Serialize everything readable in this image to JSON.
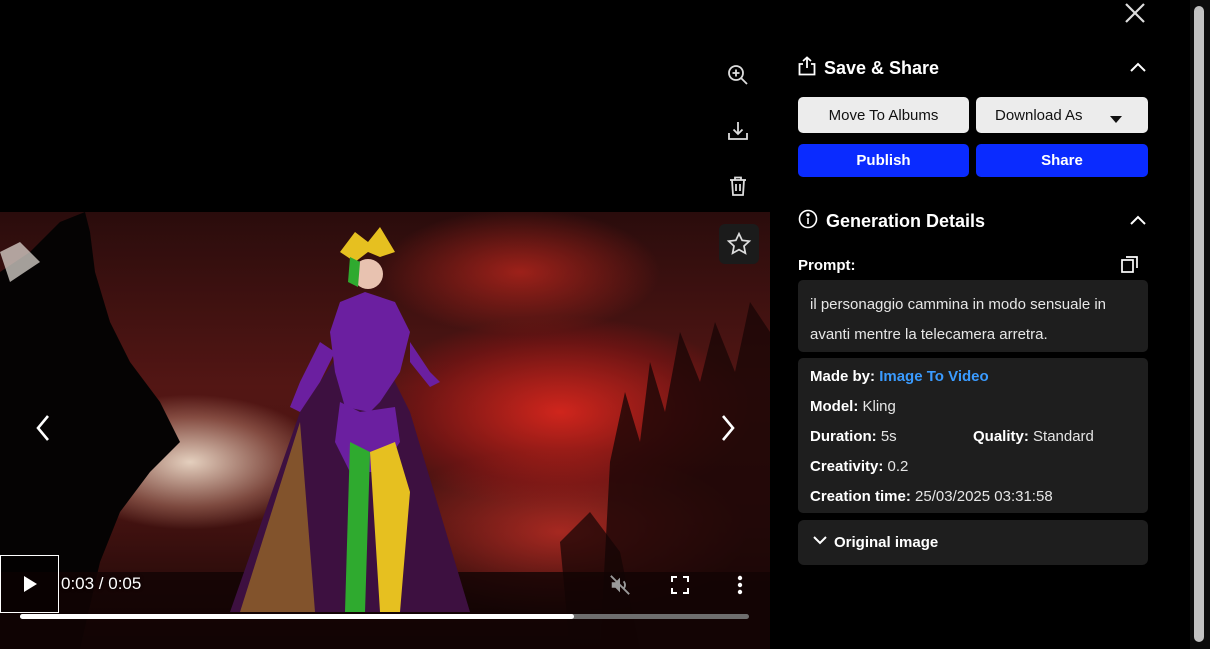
{
  "viewer": {
    "icons": {
      "zoom": "zoom-in-icon",
      "download": "download-icon",
      "delete": "trash-icon",
      "favorite": "star-icon",
      "prev": "chevron-left-icon",
      "next": "chevron-right-icon"
    },
    "player": {
      "time_text": "0:03 / 0:05",
      "progress": 0.76,
      "icons": {
        "play": "play-icon",
        "mute": "volume-muted-icon",
        "fullscreen": "fullscreen-icon",
        "more": "more-vertical-icon"
      }
    }
  },
  "panel": {
    "close_icon": "close-icon",
    "save_share": {
      "title": "Save & Share",
      "icon": "share-upload-icon",
      "buttons": {
        "move_to_albums": "Move To Albums",
        "download_as": "Download As",
        "publish": "Publish",
        "share": "Share"
      }
    },
    "generation_details": {
      "title": "Generation Details",
      "icon": "info-icon",
      "prompt_label": "Prompt:",
      "prompt_text": "il personaggio cammina in modo sensuale in avanti mentre la telecamera arretra.",
      "made_by_label": "Made by:",
      "made_by_value": "Image To Video",
      "model_label": "Model:",
      "model_value": "Kling",
      "duration_label": "Duration:",
      "duration_value": "5s",
      "quality_label": "Quality:",
      "quality_value": "Standard",
      "creativity_label": "Creativity:",
      "creativity_value": "0.2",
      "creation_time_label": "Creation time:",
      "creation_time_value": "25/03/2025 03:31:58",
      "original_image_label": "Original image"
    }
  },
  "colors": {
    "accent_blue": "#0a2bff",
    "link_blue": "#3a9bff",
    "panel_bg": "#1e1e1e"
  }
}
